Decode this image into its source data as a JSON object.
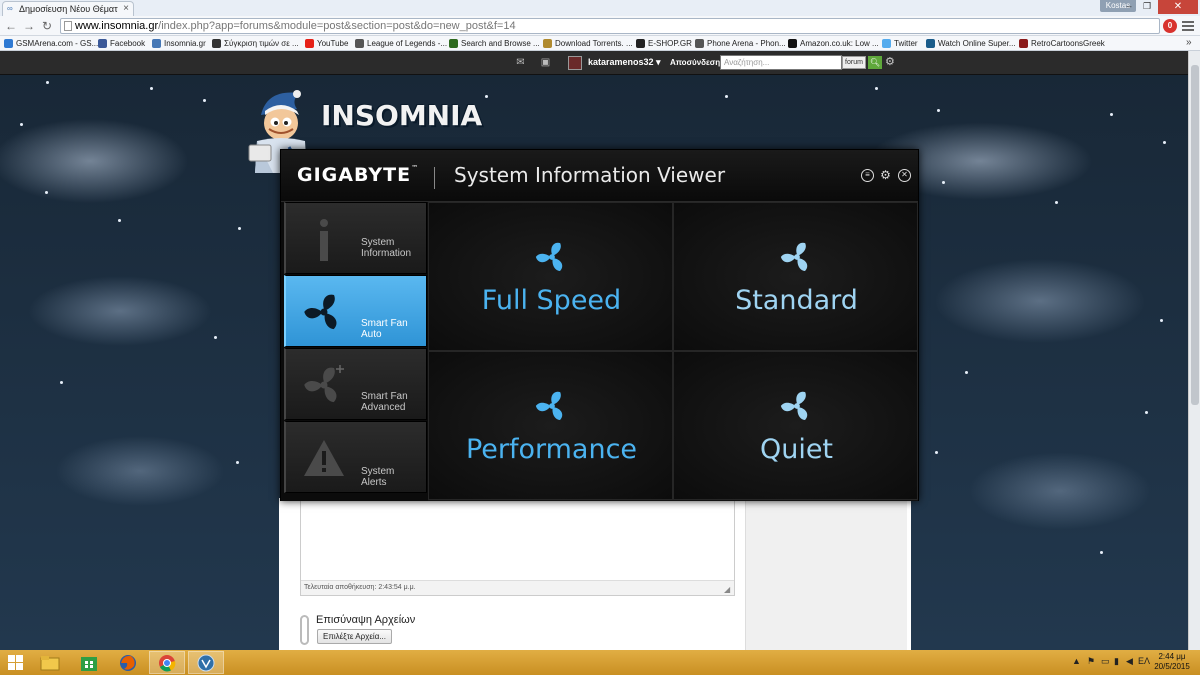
{
  "browser": {
    "tab_title": "Δημοσίευση Νέου Θέματ",
    "tab_close": "×",
    "user_badge": "Kostas",
    "url_host": "www.insomnia.gr",
    "url_path": "/index.php?app=forums&module=post&section=post&do=new_post&f=14",
    "bookmarks": [
      {
        "label": "GSMArena.com - GS...",
        "color": "#2f7ad3"
      },
      {
        "label": "Facebook",
        "color": "#3b5998"
      },
      {
        "label": "Insomnia.gr",
        "color": "#4577b5"
      },
      {
        "label": "Σύγκριση τιμών σε ...",
        "color": "#333333"
      },
      {
        "label": "YouTube",
        "color": "#e62117"
      },
      {
        "label": "League of Legends -...",
        "color": "#555555"
      },
      {
        "label": "Search and Browse ...",
        "color": "#2d6a1e"
      },
      {
        "label": "Download Torrents. ...",
        "color": "#b08a2e"
      },
      {
        "label": "E-SHOP.GR",
        "color": "#222222"
      },
      {
        "label": "Phone Arena - Phon...",
        "color": "#555555"
      },
      {
        "label": "Amazon.co.uk: Low ...",
        "color": "#111111"
      },
      {
        "label": "Twitter",
        "color": "#55acee"
      },
      {
        "label": "Watch Online Super...",
        "color": "#1a5c8a"
      },
      {
        "label": "RetroCartoonsGreek",
        "color": "#8a1a1a"
      }
    ],
    "bookmarks_more": "»"
  },
  "site": {
    "username": "kataramenos32 ▾",
    "logout": "Αποσύνδεση",
    "search_placeholder": "Αναζήτηση...",
    "search_scope": "forum",
    "logo_text": "INSOMNIA"
  },
  "editor": {
    "last_saved": "Τελευταία αποθήκευση: 2:43:54 μ.μ.",
    "attachments_title": "Επισύναψη Αρχείων",
    "choose_files_button": "Επιλέξτε Αρχεία..."
  },
  "gigabyte": {
    "brand": "GIGABYTE",
    "brand_tm": "™",
    "title": "System Information Viewer",
    "sidebar": [
      {
        "label_line1": "System",
        "label_line2": "Information",
        "icon": "info-icon",
        "active": false
      },
      {
        "label_line1": "Smart Fan",
        "label_line2": "Auto",
        "icon": "fan-icon",
        "active": true
      },
      {
        "label_line1": "Smart Fan",
        "label_line2": "Advanced",
        "icon": "fan-plus-icon",
        "active": false
      },
      {
        "label_line1": "System",
        "label_line2": "Alerts",
        "icon": "warning-icon",
        "active": false
      }
    ],
    "modes": [
      {
        "label": "Full Speed",
        "color": "#4bb3f0"
      },
      {
        "label": "Standard",
        "color": "#9fd4f2"
      },
      {
        "label": "Performance",
        "color": "#4bb3f0"
      },
      {
        "label": "Quiet",
        "color": "#9fd4f2"
      }
    ]
  },
  "taskbar": {
    "language": "ΕΛ",
    "time": "2:44 μμ",
    "date": "20/5/2015"
  }
}
